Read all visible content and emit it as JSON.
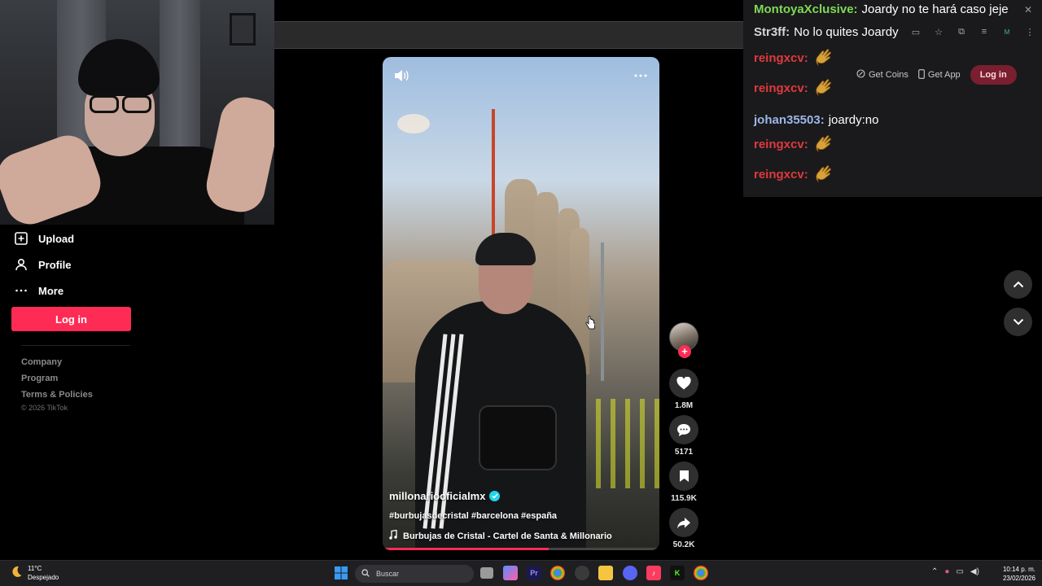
{
  "sidebar": {
    "items": [
      {
        "label": "Upload",
        "icon": "plus-square-icon"
      },
      {
        "label": "Profile",
        "icon": "person-icon"
      },
      {
        "label": "More",
        "icon": "more-dots-icon"
      }
    ],
    "login_label": "Log in",
    "footer": [
      "Company",
      "Program",
      "Terms & Policies"
    ],
    "copyright": "© 2026 TikTok"
  },
  "video": {
    "username": "millonariooficialmx",
    "verified": true,
    "hashtags": "#burbujasdecristal #barcelona #españa",
    "music": "Burbujas de Cristal - Cartel de Santa & Millonario",
    "progress": 0.6
  },
  "actions": {
    "likes": "1.8M",
    "comments": "5171",
    "saves": "115.9K",
    "shares": "50.2K"
  },
  "chat": {
    "messages": [
      {
        "user": "MontoyaXclusive:",
        "text": "Joardy no te hará caso jeje",
        "color": "#7ed957",
        "emote": false
      },
      {
        "user": "Str3ff:",
        "text": "No lo quites Joardy",
        "color": "#d6d6d6",
        "emote": false
      },
      {
        "user": "reingxcv:",
        "text": "",
        "color": "#e0393e",
        "emote": true
      },
      {
        "user": "reingxcv:",
        "text": "",
        "color": "#e0393e",
        "emote": true
      },
      {
        "user": "johan35503:",
        "text": "joardy:no",
        "color": "#9cb7e8",
        "emote": false
      },
      {
        "user": "reingxcv:",
        "text": "",
        "color": "#e0393e",
        "emote": true
      },
      {
        "user": "reingxcv:",
        "text": "",
        "color": "#e0393e",
        "emote": true
      }
    ]
  },
  "tiktok_header": {
    "get_coins": "Get Coins",
    "get_app": "Get App",
    "login": "Log in"
  },
  "taskbar": {
    "weather_temp": "11°C",
    "weather_desc": "Despejado",
    "search_placeholder": "Buscar",
    "time": "10:14 p. m.",
    "date": "23/02/2026"
  },
  "colors": {
    "accent": "#fe2c55",
    "background": "#000000"
  }
}
